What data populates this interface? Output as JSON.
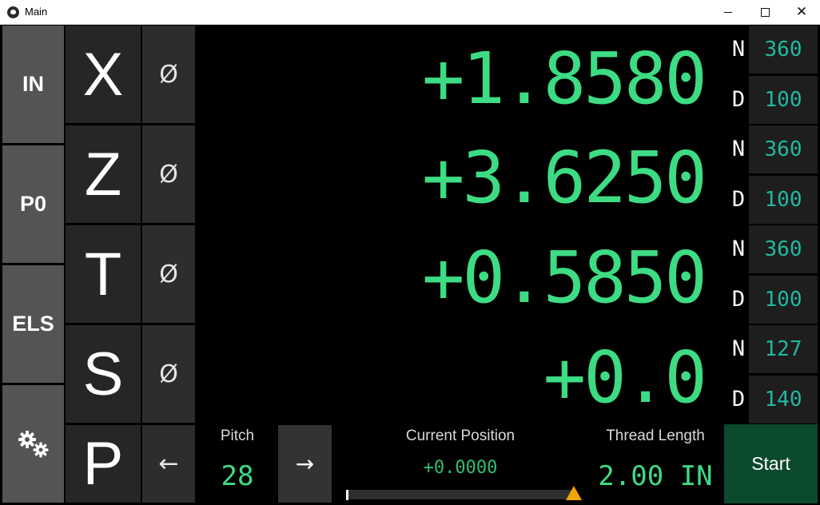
{
  "window": {
    "title": "Main",
    "minimize_icon": "minimize-icon",
    "maximize_icon": "maximize-icon",
    "close_icon": "close-icon",
    "close_glyph": "✕"
  },
  "modes": [
    {
      "label": "IN"
    },
    {
      "label": "P0"
    },
    {
      "label": "ELS"
    },
    {
      "label": "",
      "icon": "gears-icon",
      "glyph": "⚙⚙"
    }
  ],
  "axes": [
    {
      "label": "X",
      "zero_glyph": "Ø",
      "display": "+1.8580",
      "N": "360",
      "D": "100"
    },
    {
      "label": "Z",
      "zero_glyph": "Ø",
      "display": "+3.6250",
      "N": "360",
      "D": "100"
    },
    {
      "label": "T",
      "zero_glyph": "Ø",
      "display": "+0.5850",
      "N": "360",
      "D": "100"
    },
    {
      "label": "S",
      "zero_glyph": "Ø",
      "display": "+0.0",
      "N": "127",
      "D": "140"
    }
  ],
  "nd_labels": {
    "n": "N",
    "d": "D"
  },
  "pitch": {
    "axis_label": "P",
    "left_glyph": "←",
    "label": "Pitch",
    "value": "28",
    "right_glyph": "→"
  },
  "position": {
    "label": "Current Position",
    "value": "+0.0000",
    "progress_fraction": 0.0
  },
  "thread_length": {
    "label": "Thread Length",
    "value": "2.00 IN"
  },
  "start_button": {
    "label": "Start"
  },
  "colors": {
    "display_green": "#3ddc84",
    "nd_teal": "#22b8a0",
    "start_bg": "#0b4a2c",
    "marker": "#f0a500"
  }
}
